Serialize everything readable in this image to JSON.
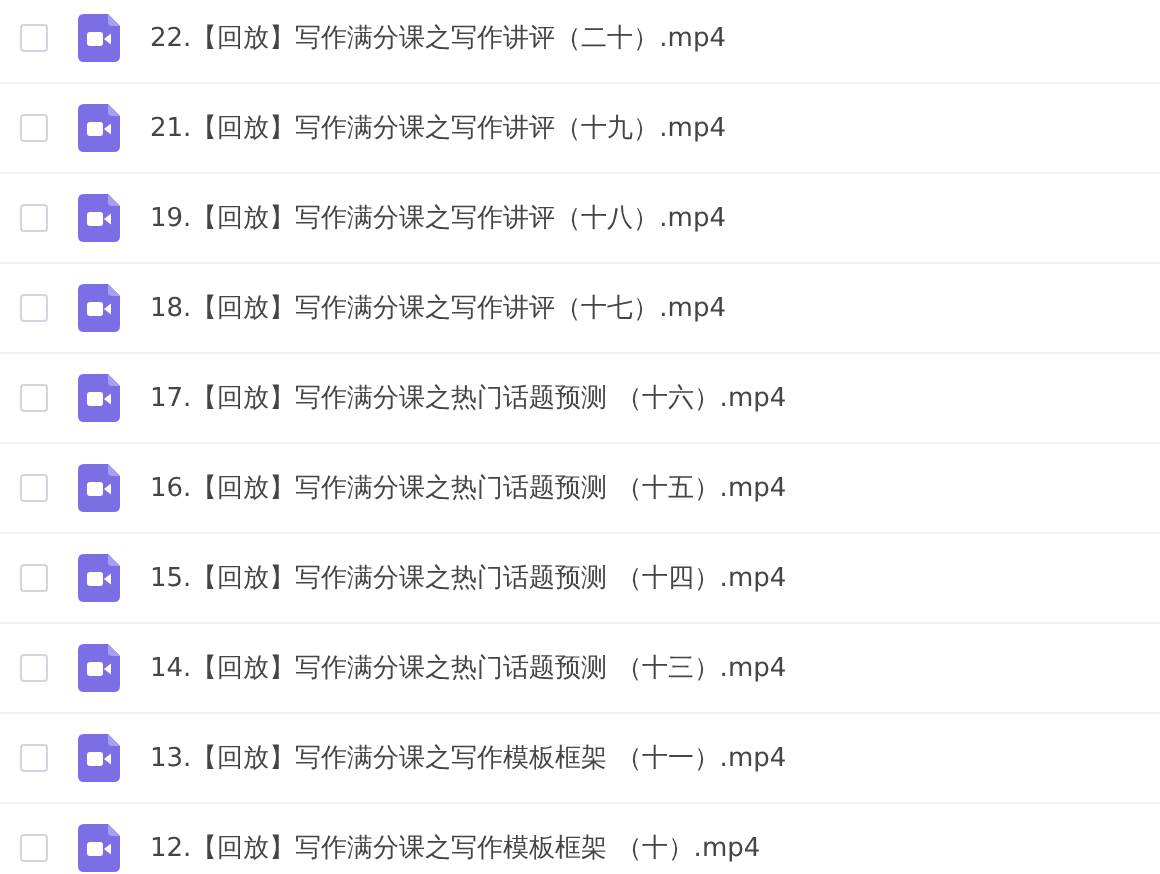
{
  "files": [
    {
      "name": "22.【回放】写作满分课之写作讲评（二十）.mp4",
      "checked": false
    },
    {
      "name": "21.【回放】写作满分课之写作讲评（十九）.mp4",
      "checked": false
    },
    {
      "name": "19.【回放】写作满分课之写作讲评（十八）.mp4",
      "checked": false
    },
    {
      "name": "18.【回放】写作满分课之写作讲评（十七）.mp4",
      "checked": false
    },
    {
      "name": "17.【回放】写作满分课之热门话题预测 （十六）.mp4",
      "checked": false
    },
    {
      "name": "16.【回放】写作满分课之热门话题预测 （十五）.mp4",
      "checked": false
    },
    {
      "name": "15.【回放】写作满分课之热门话题预测 （十四）.mp4",
      "checked": false
    },
    {
      "name": "14.【回放】写作满分课之热门话题预测 （十三）.mp4",
      "checked": false
    },
    {
      "name": "13.【回放】写作满分课之写作模板框架 （十一）.mp4",
      "checked": false
    },
    {
      "name": "12.【回放】写作满分课之写作模板框架 （十）.mp4",
      "checked": false
    }
  ]
}
